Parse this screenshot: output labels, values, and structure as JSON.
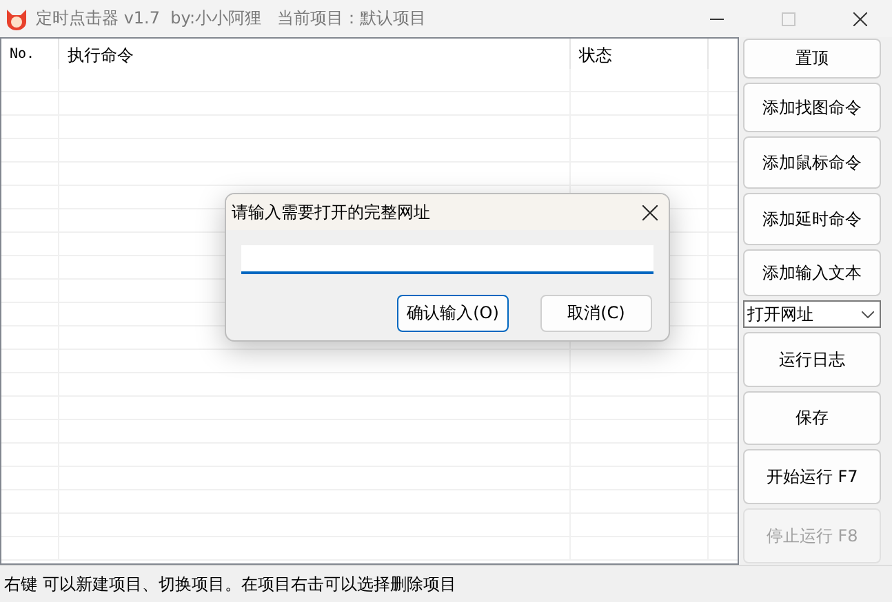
{
  "window": {
    "title": "定时点击器 v1.7  by:小小阿狸   当前项目：默认项目",
    "maximize_disabled": true
  },
  "table": {
    "columns": [
      {
        "label": "No."
      },
      {
        "label": "执行命令"
      },
      {
        "label": "状态"
      }
    ]
  },
  "sidebar": {
    "items": [
      {
        "kind": "button",
        "label": "置顶",
        "disabled": false
      },
      {
        "kind": "button",
        "label": "添加找图命令",
        "disabled": false
      },
      {
        "kind": "button",
        "label": "添加鼠标命令",
        "disabled": false
      },
      {
        "kind": "button",
        "label": "添加延时命令",
        "disabled": false
      },
      {
        "kind": "button",
        "label": "添加输入文本",
        "disabled": false
      },
      {
        "kind": "dropdown",
        "label": "打开网址"
      },
      {
        "kind": "button",
        "label": "运行日志",
        "disabled": false
      },
      {
        "kind": "button",
        "label": "保存",
        "disabled": false
      },
      {
        "kind": "button",
        "label": "开始运行 F7",
        "disabled": false
      },
      {
        "kind": "button",
        "label": "停止运行 F8",
        "disabled": true
      }
    ]
  },
  "status_bar": "右键 可以新建项目、切换项目。在项目右击可以选择删除项目",
  "dialog": {
    "title": "请输入需要打开的完整网址",
    "buttons": [
      {
        "label": "确认输入(O)",
        "default": true
      },
      {
        "label": "取消(C)",
        "default": false
      }
    ]
  }
}
